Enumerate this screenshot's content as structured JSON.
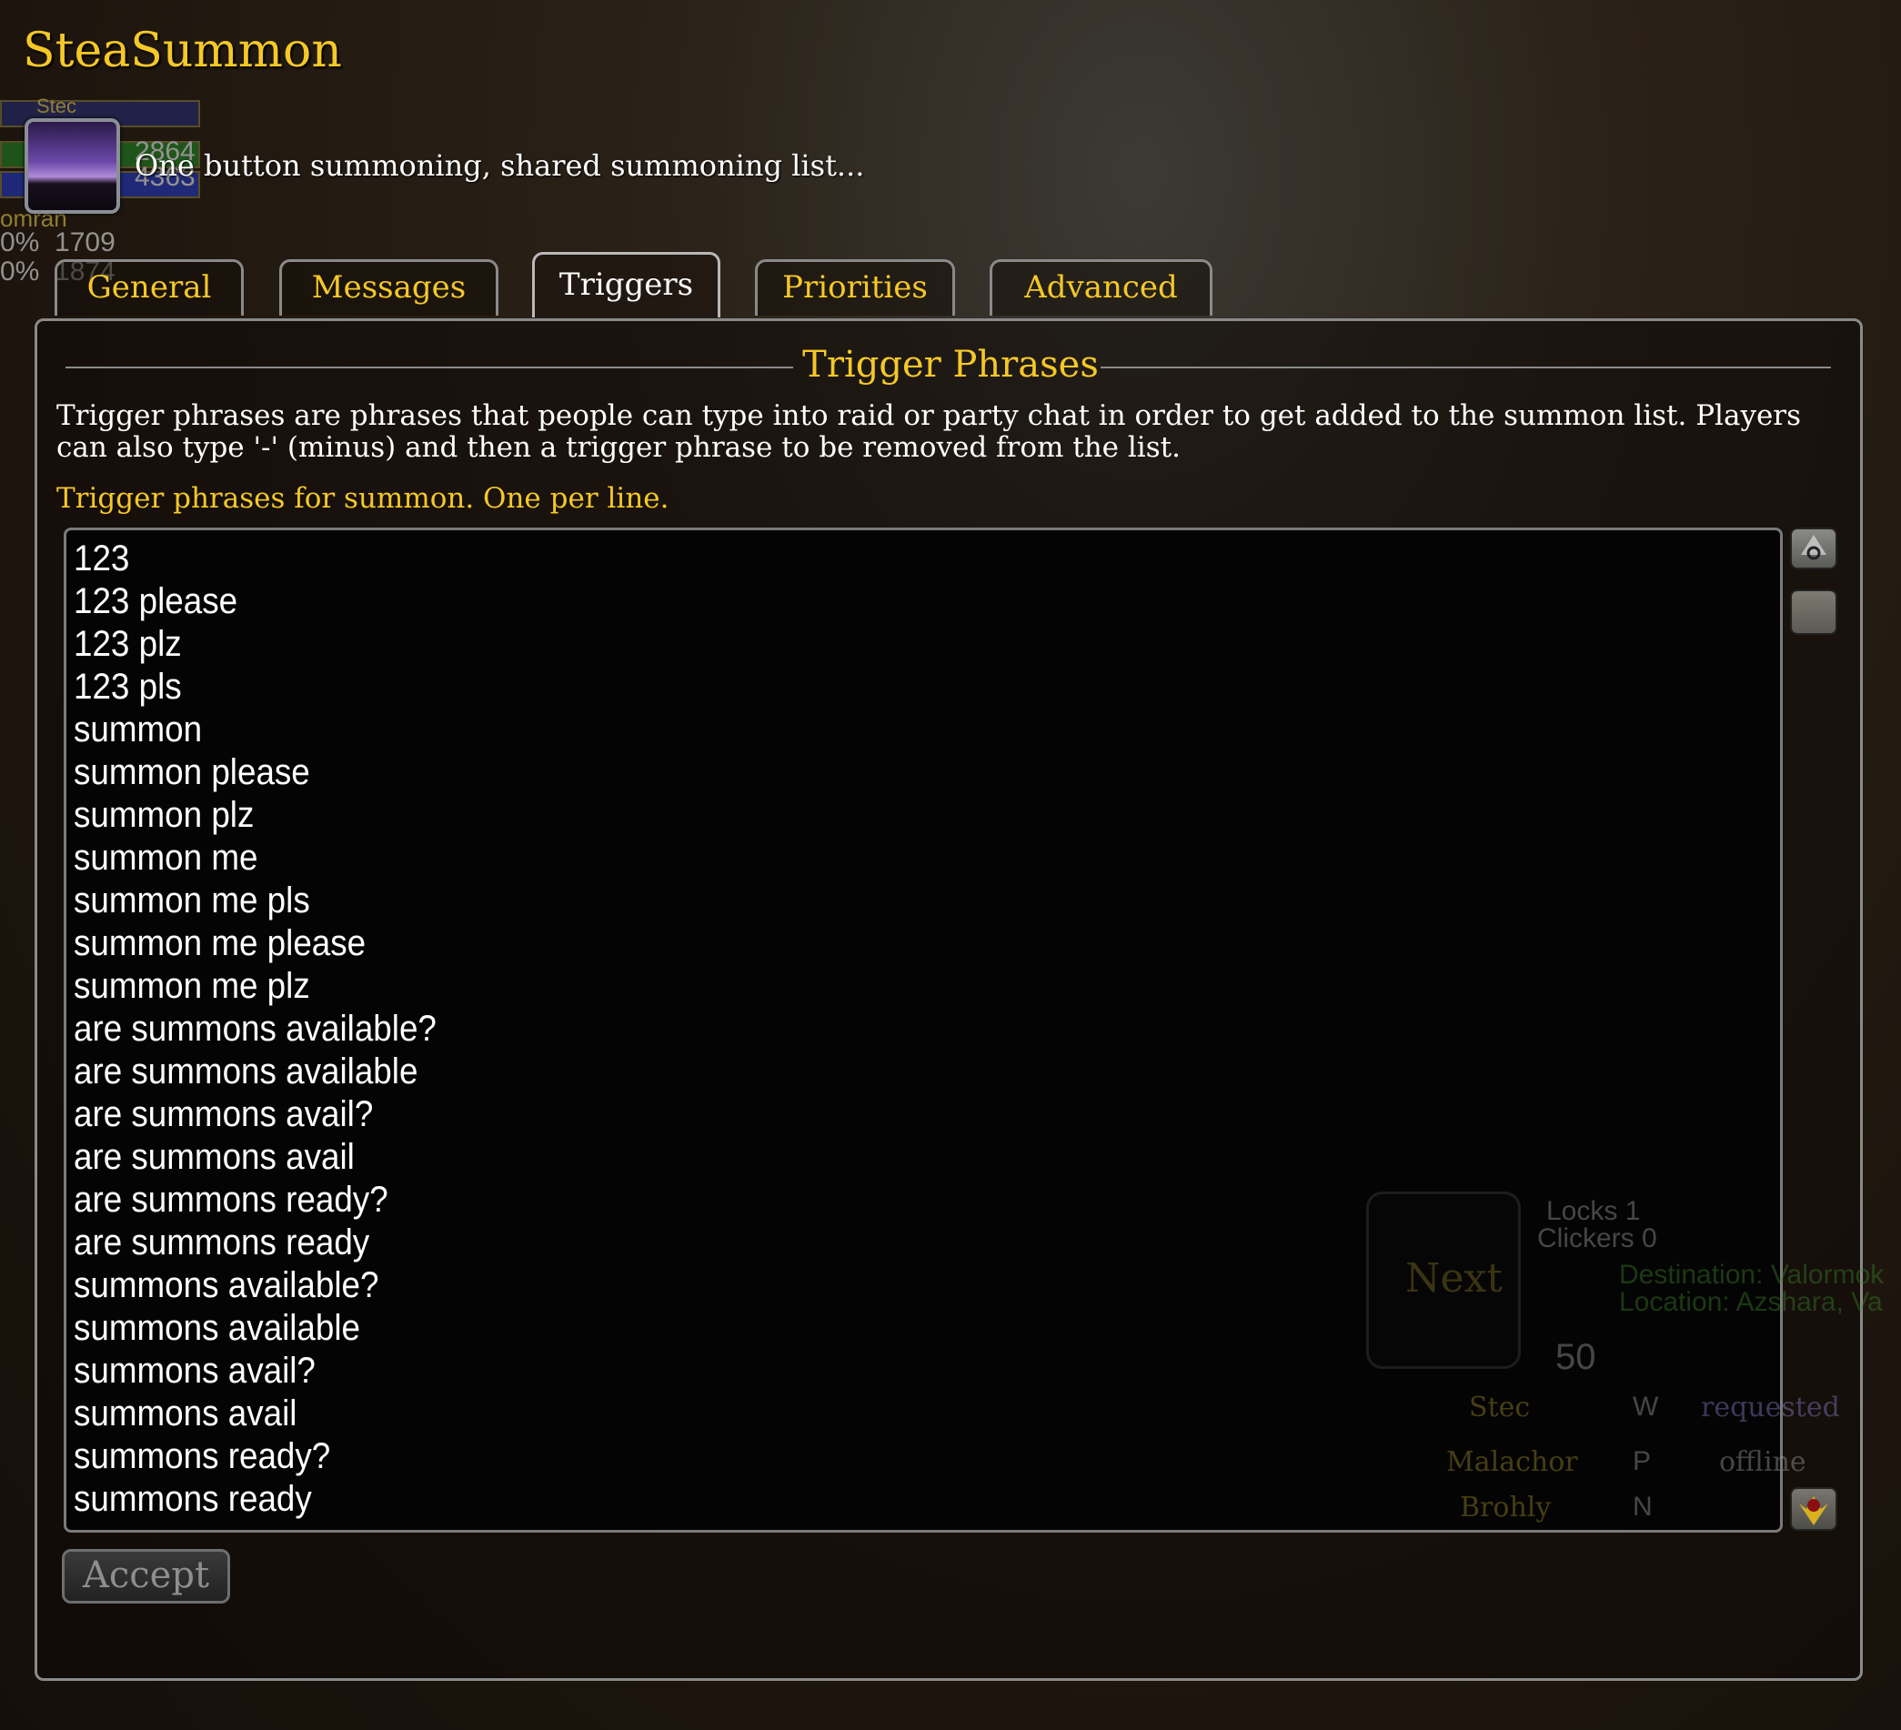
{
  "app": {
    "title": "SteaSummon",
    "subtitle": "One button summoning, shared summoning list...",
    "icon": "summon-portal-icon"
  },
  "unit_frames": {
    "name1": "Stec",
    "hp1": "2864",
    "mana1": "4363",
    "name2": "omran",
    "pct1": "0%",
    "val1": "1709",
    "pct2": "0%",
    "val2": "1874"
  },
  "tabs": [
    {
      "label": "General"
    },
    {
      "label": "Messages"
    },
    {
      "label": "Triggers",
      "active": true
    },
    {
      "label": "Priorities"
    },
    {
      "label": "Advanced"
    }
  ],
  "triggers": {
    "section_title": "Trigger Phrases",
    "description": "Trigger phrases are phrases that people can type into raid or party chat in order to get added to the summon list. Players can also type '-' (minus) and then a trigger phrase to be removed from the list.",
    "field_label": "Trigger phrases for summon. One per line.",
    "phrases": [
      "123",
      "123 please",
      "123 plz",
      "123 pls",
      "summon",
      "summon please",
      "summon plz",
      "summon me",
      "summon me pls",
      "summon me please",
      "summon me plz",
      "are summons available?",
      "are summons available",
      "are summons avail?",
      "are summons avail",
      "are summons ready?",
      "are summons ready",
      "summons available?",
      "summons available",
      "summons avail?",
      "summons avail",
      "summons ready?",
      "summons ready"
    ],
    "accept_label": "Accept"
  },
  "background_window": {
    "locks": "Locks 1",
    "clickers": "Clickers 0",
    "next": "Next",
    "destination": "Destination: Valormok",
    "location": "Location: Azshara, Va",
    "count": "50",
    "rows": [
      {
        "name": "Stec",
        "tag": "W",
        "status": "requested"
      },
      {
        "name": "Malachor",
        "tag": "P",
        "status": "offline"
      },
      {
        "name": "Brohly",
        "tag": "N",
        "status": ""
      }
    ]
  },
  "colors": {
    "gold": "#f5c828",
    "text": "#ffffff",
    "border": "#8a8a8a"
  }
}
